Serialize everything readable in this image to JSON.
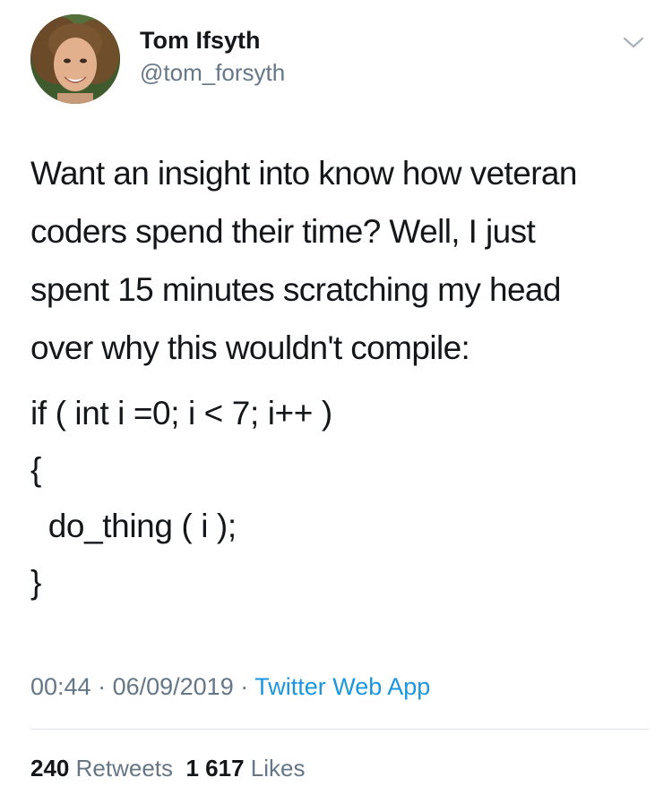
{
  "tweet": {
    "author": {
      "display_name": "Tom Ifsyth",
      "handle": "@tom_forsyth",
      "avatar_icon": "profile-photo"
    },
    "more_icon": "chevron-down-icon",
    "text_lines": [
      "Want an insight into know how veteran",
      "coders spend their time? Well, I just",
      "spent 15 minutes scratching my head",
      "over why this wouldn't compile:"
    ],
    "code_lines": [
      "if ( int i =0; i < 7; i++ )",
      "{",
      "  do_thing ( i );",
      "}"
    ],
    "meta": {
      "time": "00:44",
      "separator": " · ",
      "date": "06/09/2019",
      "source": "Twitter Web App"
    },
    "stats": {
      "retweets_count": "240",
      "retweets_label": "Retweets",
      "likes_count": "1 617",
      "likes_label": "Likes"
    },
    "colors": {
      "text": "#14171a",
      "secondary": "#657786",
      "link": "#1b95e0",
      "divider": "#dde3e8"
    }
  }
}
